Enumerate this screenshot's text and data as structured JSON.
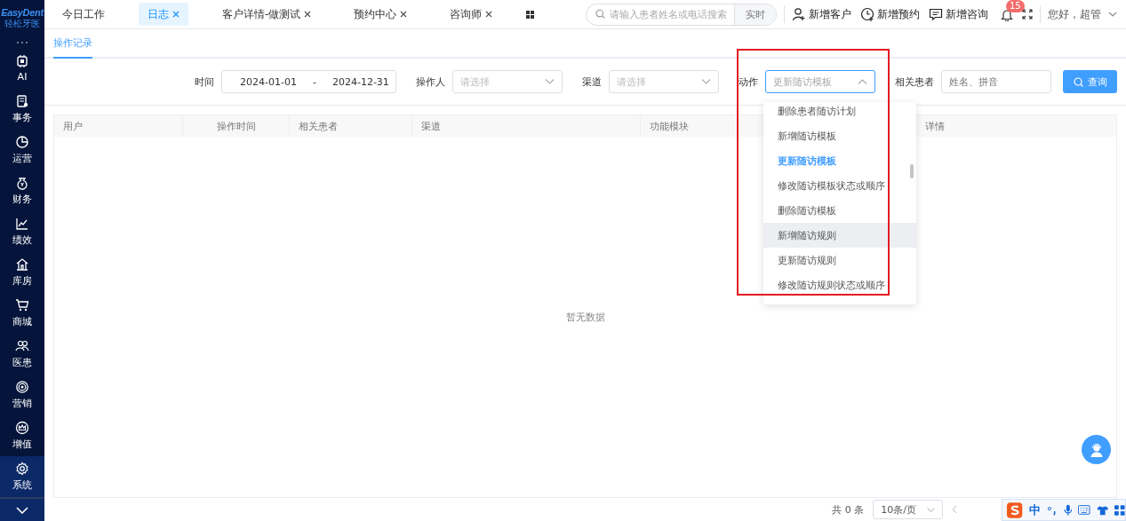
{
  "sidebar": {
    "logo": {
      "title": "EasyDent",
      "subtitle": "轻松牙医"
    },
    "items": [
      {
        "label": "AI",
        "selected": false
      },
      {
        "label": "事务",
        "selected": false
      },
      {
        "label": "运营",
        "selected": false
      },
      {
        "label": "财务",
        "selected": false
      },
      {
        "label": "绩效",
        "selected": false
      },
      {
        "label": "库房",
        "selected": false
      },
      {
        "label": "商城",
        "selected": false
      },
      {
        "label": "医患",
        "selected": false
      },
      {
        "label": "营销",
        "selected": false
      },
      {
        "label": "增值",
        "selected": false
      },
      {
        "label": "系统",
        "selected": true
      }
    ]
  },
  "tabs": [
    {
      "label": "今日工作",
      "selected": false,
      "closable": false
    },
    {
      "label": "日志",
      "selected": true,
      "closable": true
    },
    {
      "label": "客户详情-做测试",
      "selected": false,
      "closable": true
    },
    {
      "label": "预约中心",
      "selected": false,
      "closable": true
    },
    {
      "label": "咨询师",
      "selected": false,
      "closable": true
    }
  ],
  "search": {
    "placeholder": "请输入患者姓名或电话搜索",
    "button": "实时"
  },
  "actions": [
    {
      "label": "新增客户"
    },
    {
      "label": "新增预约"
    },
    {
      "label": "新增咨询"
    }
  ],
  "notifications": {
    "badge": "15"
  },
  "user": {
    "greeting": "您好，超管"
  },
  "subtabs": [
    {
      "label": "操作记录",
      "selected": true
    }
  ],
  "filters": [
    {
      "kind": "date-range",
      "label": "时间",
      "start": "2024-01-01",
      "separator": "-",
      "end": "2024-12-31"
    },
    {
      "kind": "select",
      "label": "操作人",
      "placeholder": "请选择",
      "open": false
    },
    {
      "kind": "select",
      "label": "渠道",
      "placeholder": "请选择",
      "open": false
    },
    {
      "kind": "select",
      "label": "动作",
      "placeholder": "更新随访模板",
      "open": true
    },
    {
      "kind": "input",
      "label": "相关患者",
      "placeholder": "姓名、拼音"
    }
  ],
  "query_button": "查询",
  "dropdown": {
    "items": [
      {
        "label": "删除患者随访计划",
        "selected": false,
        "hovered": false
      },
      {
        "label": "新增随访模板",
        "selected": false,
        "hovered": false
      },
      {
        "label": "更新随访模板",
        "selected": true,
        "hovered": false
      },
      {
        "label": "修改随访模板状态或顺序",
        "selected": false,
        "hovered": false
      },
      {
        "label": "删除随访模板",
        "selected": false,
        "hovered": false
      },
      {
        "label": "新增随访规则",
        "selected": false,
        "hovered": true
      },
      {
        "label": "更新随访规则",
        "selected": false,
        "hovered": false
      },
      {
        "label": "修改随访规则状态或顺序",
        "selected": false,
        "hovered": false
      }
    ]
  },
  "table": {
    "columns": [
      "用户",
      "操作时间",
      "相关患者",
      "渠道",
      "功能模块",
      "详情"
    ],
    "empty_text": "暂无数据"
  },
  "pagination": {
    "total": "共 0 条",
    "page_size": "10条/页"
  },
  "ime_toolbar": {
    "label": "中"
  }
}
